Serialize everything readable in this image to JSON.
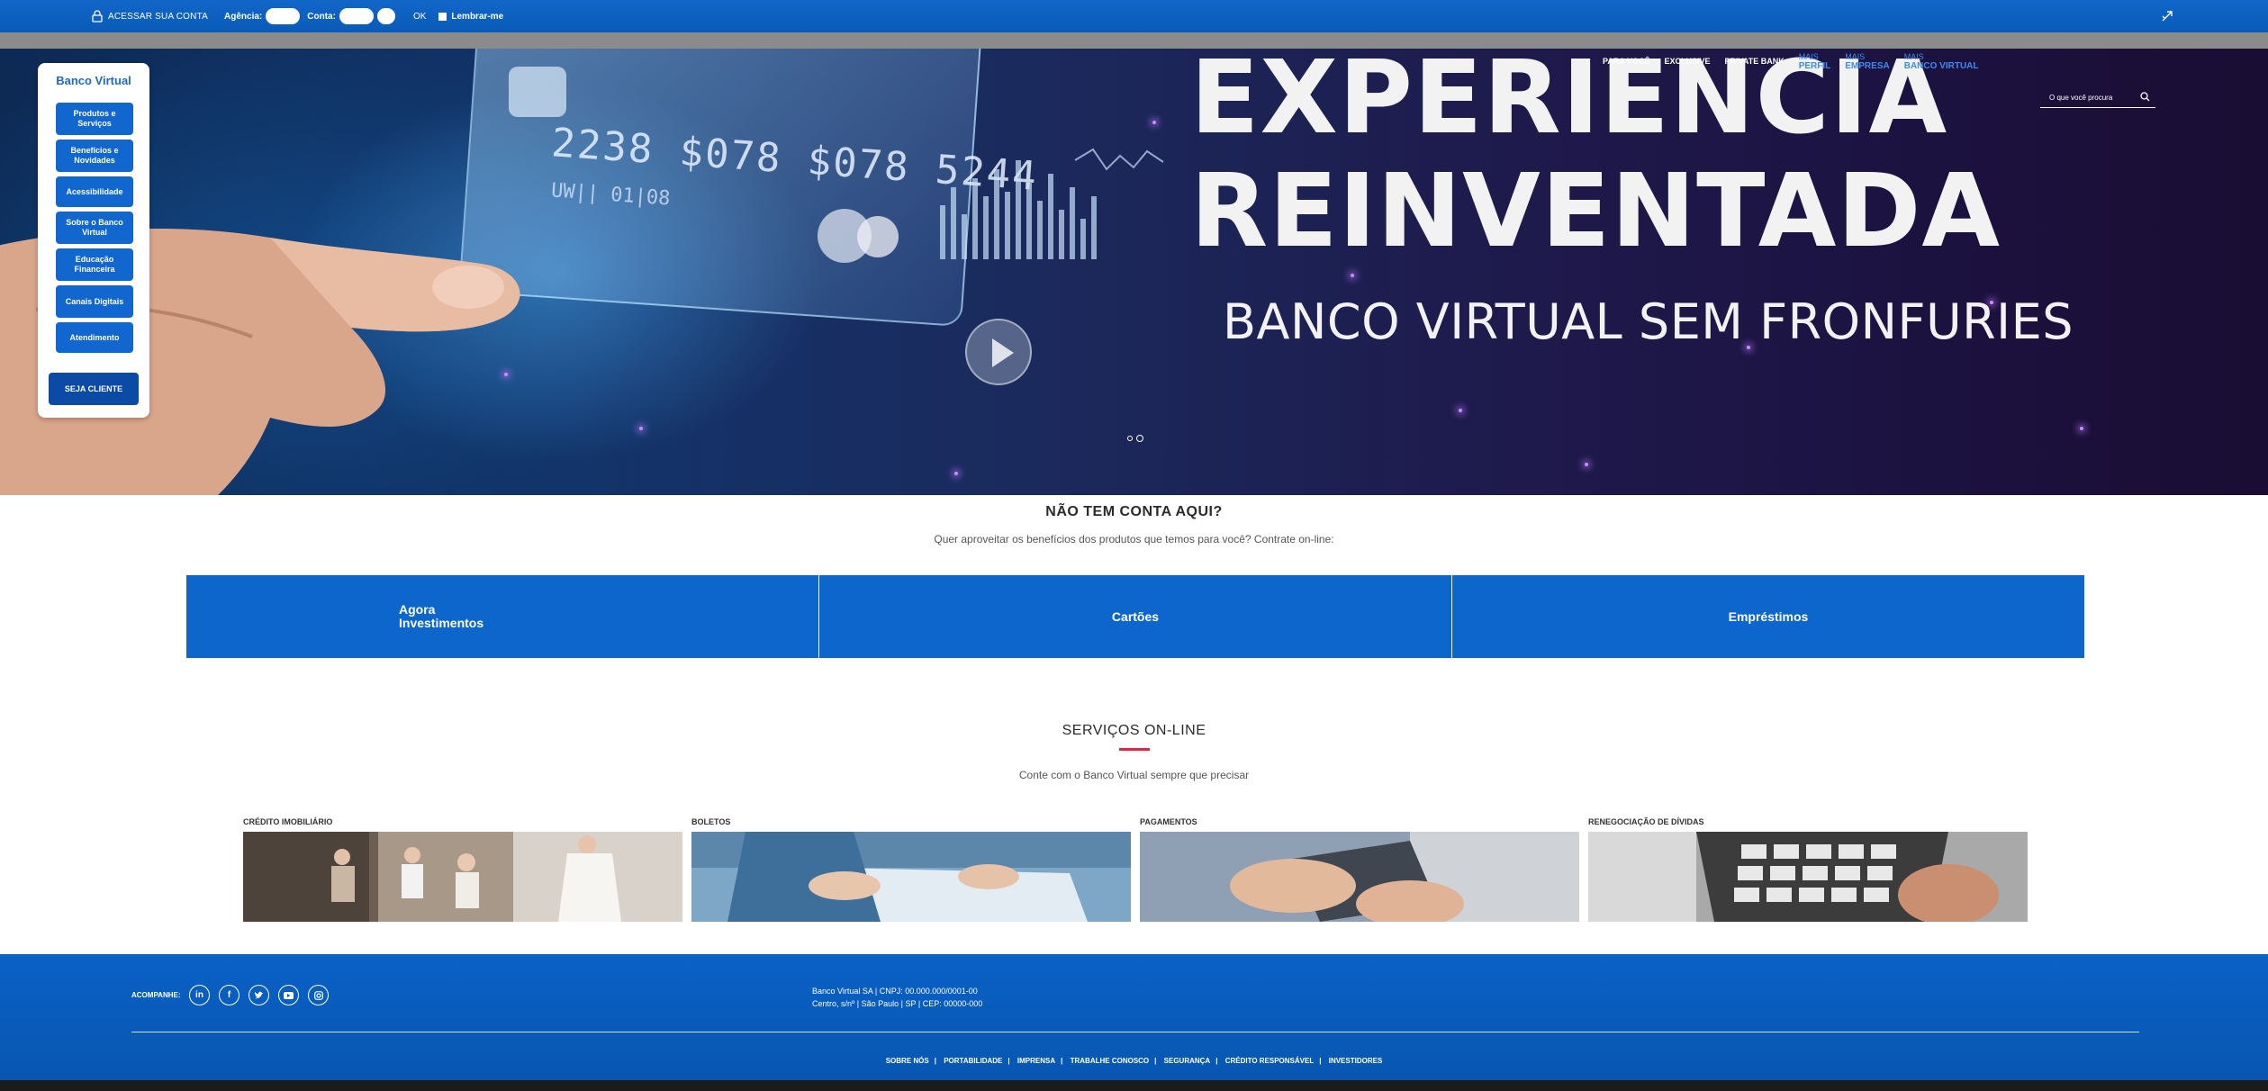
{
  "topbar": {
    "access_label": "ACESSAR SUA CONTA",
    "agency_label": "Agência:",
    "account_label": "Conta:",
    "ok_label": "OK",
    "remember_label": "Lembrar-me"
  },
  "hero": {
    "card_number": "2238 $078 $078 5244",
    "card_small": "UW|| 01|08",
    "headline_line1": "EXPERIENCIA",
    "headline_line2": "REINVENTADA",
    "subheadline": "BANCO VIRTUAL SEM FRONFURIES"
  },
  "nav": {
    "items": [
      {
        "label": "PARA VOCÊ"
      },
      {
        "label": "EXCLUSIVE"
      },
      {
        "label": "PRIVATE BANK"
      }
    ],
    "perfil_small": "MAIS",
    "perfil_label": "PERFIL",
    "empresa_small": "MAIS",
    "empresa_label": "EMPRESA",
    "banco_small": "MAIS",
    "banco_label": "BANCO VIRTUAL"
  },
  "search": {
    "placeholder": "O que você procura"
  },
  "side": {
    "title": "Banco Virtual",
    "items": [
      {
        "label": "Produtos e Serviços"
      },
      {
        "label": "Benefícios e Novidades"
      },
      {
        "label": "Acessibilidade"
      },
      {
        "label": "Sobre o Banco Virtual"
      },
      {
        "label": "Educação Financeira"
      },
      {
        "label": "Canais Digitais"
      },
      {
        "label": "Atendimento"
      }
    ],
    "cta": "SEJA CLIENTE"
  },
  "account": {
    "title": "NÃO TEM CONTA AQUI?",
    "subtitle": "Quer aproveitar os benefícios dos produtos que temos para você? Contrate on-line:",
    "tiles": [
      {
        "label": "Agora Investimentos"
      },
      {
        "label": "Cartões"
      },
      {
        "label": "Empréstimos"
      }
    ]
  },
  "services": {
    "title": "SERVIÇOS ON-LINE",
    "subtitle": "Conte com o Banco Virtual sempre que precisar",
    "items": [
      {
        "label": "CRÉDITO IMOBILIÁRIO"
      },
      {
        "label": "BOLETOS"
      },
      {
        "label": "PAGAMENTOS"
      },
      {
        "label": "RENEGOCIAÇÃO DE DÍVIDAS"
      }
    ]
  },
  "footer": {
    "follow_label": "ACOMPANHE:",
    "address_line1": "Banco Virtual SA | CNPJ: 00.000.000/0001-00",
    "address_line2": "Centro, s/nº | São Paulo | SP | CEP: 00000-000",
    "links": [
      "SOBRE NÓS",
      "PORTABILIDADE",
      "IMPRENSA",
      "TRABALHE CONOSCO",
      "SEGURANÇA",
      "CRÉDITO RESPONSÁVEL",
      "INVESTIDORES"
    ],
    "social": [
      "in",
      "f",
      "t",
      "yt",
      "ig"
    ]
  },
  "colors": {
    "brand_blue": "#0d66cc",
    "dark_blue": "#0b4aa5",
    "accent_red": "#e3263a"
  }
}
